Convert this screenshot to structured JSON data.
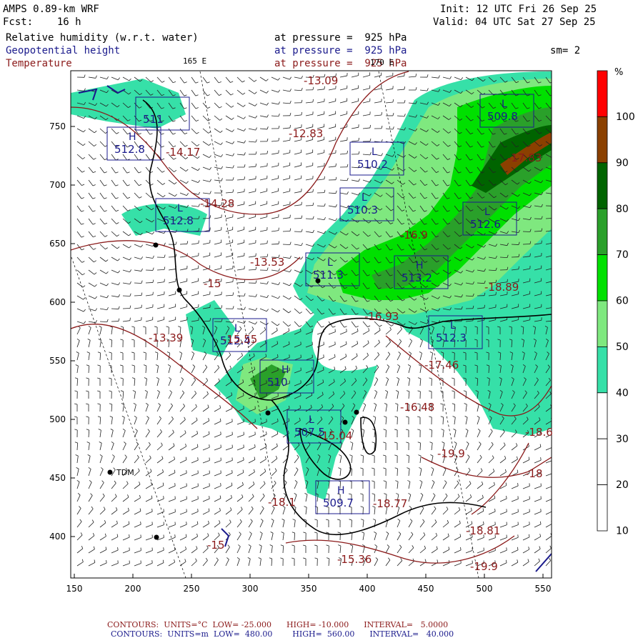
{
  "header": {
    "model": "AMPS 0.89-km WRF",
    "fcst_label": "Fcst:",
    "fcst_hours": "16 h",
    "init": "Init: 12 UTC Fri 26 Sep 25",
    "valid": "Valid: 04 UTC Sat 27 Sep 25",
    "rh_title": "Relative humidity (w.r.t. water)",
    "gph_title": "Geopotential height",
    "temp_title": "Temperature",
    "pressure_text": "at pressure =  925 hPa",
    "smoothing": "sm= 2",
    "lon_label_left": "165 E",
    "lon_label_right": "170 E"
  },
  "axes": {
    "x_ticks": [
      "150",
      "200",
      "250",
      "300",
      "350",
      "400",
      "450",
      "500",
      "550"
    ],
    "y_ticks": [
      "750",
      "700",
      "650",
      "600",
      "550",
      "500",
      "450",
      "400"
    ]
  },
  "colorbar": {
    "unit": "%",
    "labels": [
      "100",
      "90",
      "80",
      "70",
      "60",
      "50",
      "40",
      "30",
      "20",
      "10"
    ],
    "colors": [
      "#ff0000",
      "#8b4000",
      "#006400",
      "#2aa02a",
      "#00e000",
      "#7fe87f",
      "#36e0a8",
      "#ffffff",
      "#ffffff",
      "#ffffff"
    ]
  },
  "station": "TDM",
  "height_labels": [
    {
      "t": "L",
      "v": "509.8"
    },
    {
      "t": "L",
      "v": "510.2"
    },
    {
      "t": "L",
      "v": "510.3"
    },
    {
      "t": "L",
      "v": "512.6"
    },
    {
      "t": "L",
      "v": "512.8"
    },
    {
      "t": "L",
      "v": "511.3"
    },
    {
      "t": "H",
      "v": "513.2"
    },
    {
      "t": "L",
      "v": "512.3"
    },
    {
      "t": "H",
      "v": "510"
    },
    {
      "t": "L",
      "v": "507.5"
    },
    {
      "t": "H",
      "v": "509.7"
    },
    {
      "t": "H",
      "v": "512.8"
    },
    {
      "t": "L",
      "v": "512.4"
    },
    {
      "t": "",
      "v": "511"
    }
  ],
  "temp_labels": [
    "-13.09",
    "-12.83",
    "-14.17",
    "-14.28",
    "-16.9",
    "-13.53",
    "-15",
    "-16.93",
    "-18.89",
    "-13.39",
    "-15.55",
    "-17.46",
    "-16.48",
    "-15.04",
    "-19.9",
    "-18.1",
    "-18.77",
    "-18.6",
    "-18",
    "-15.36",
    "-15",
    "-18.81",
    "-19.9",
    "-17.83"
  ],
  "footer": {
    "line1_label": "CONTOURS:",
    "line1_units": "UNITS=°C",
    "line1_low": "LOW= -25.000",
    "line1_high": "HIGH= -10.000",
    "line1_interval": "INTERVAL=   5.0000",
    "line2_label": "CONTOURS:",
    "line2_units": "UNITS=m",
    "line2_low": "LOW=  480.00",
    "line2_high": "HIGH=  560.00",
    "line2_interval": "INTERVAL=   40.000"
  },
  "colors": {
    "temp": "#8b1a1a",
    "gph": "#1a1a8c",
    "coast": "#000000"
  }
}
